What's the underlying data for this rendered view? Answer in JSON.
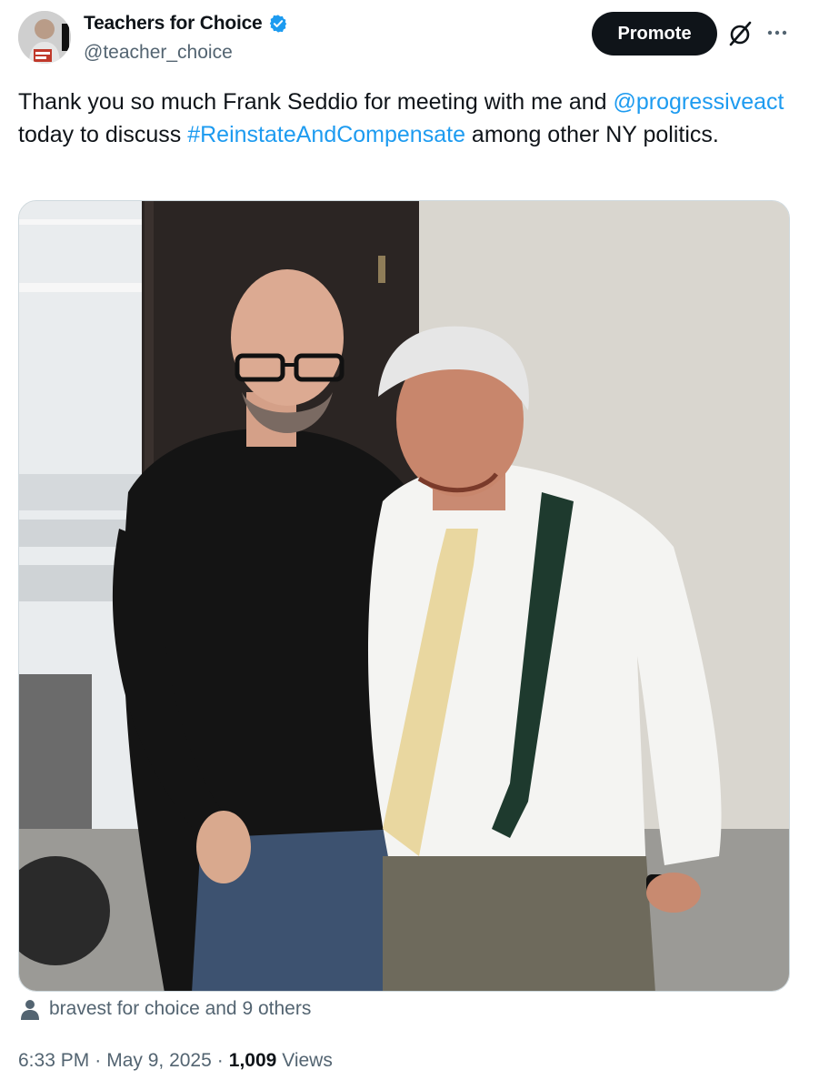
{
  "author": {
    "display_name": "Teachers for Choice",
    "handle": "@teacher_choice",
    "verified": true,
    "avatar_icon": "avatar-photo"
  },
  "actions": {
    "promote_label": "Promote",
    "grok_icon": "grok-icon",
    "more_icon": "more-dots-icon"
  },
  "tweet": {
    "text_part1": "Thank you so much Frank Seddio for meeting with me and ",
    "mention": "@progressiveact",
    "text_part2": " today to discuss ",
    "hashtag": "#ReinstateAndCompensate",
    "text_part3": " among other NY politics."
  },
  "media": {
    "type": "photo",
    "icon": "photo-image"
  },
  "tagged": {
    "icon": "person-icon",
    "text": "bravest for choice and 9 others"
  },
  "meta": {
    "time": "6:33 PM",
    "separator": "·",
    "date": "May 9, 2025",
    "views_count": "1,009",
    "views_label": "Views"
  },
  "colors": {
    "link": "#1d9bf0",
    "secondary_text": "#536471",
    "primary_text": "#0f1419",
    "verified_badge": "#1d9bf0",
    "promote_bg": "#0f1419"
  }
}
